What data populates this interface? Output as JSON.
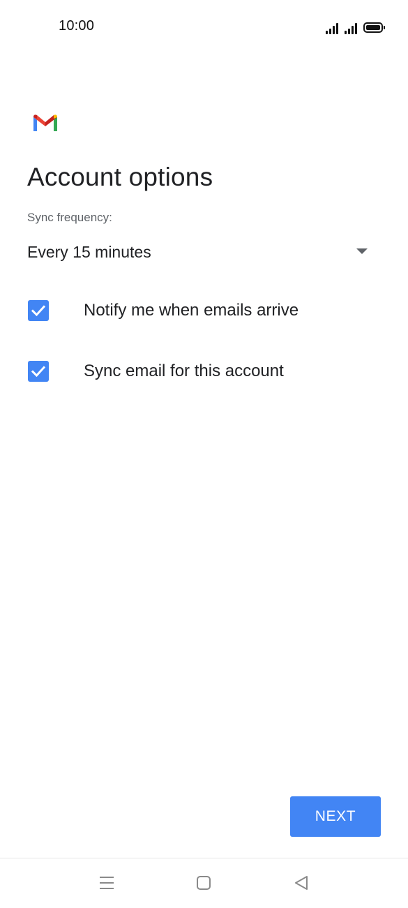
{
  "status_bar": {
    "time": "10:00",
    "icons": [
      "signal-icon",
      "signal-icon",
      "battery-icon"
    ]
  },
  "app": {
    "logo_icon": "gmail-logo-icon"
  },
  "page": {
    "title": "Account options",
    "sync_label": "Sync frequency:",
    "sync_value": "Every 15 minutes",
    "options": [
      {
        "label": "Notify me when emails arrive",
        "checked": true
      },
      {
        "label": "Sync email for this account",
        "checked": true
      }
    ],
    "next_label": "NEXT"
  },
  "nav_bar": {
    "icons": [
      "menu-icon",
      "home-icon",
      "back-icon"
    ]
  },
  "colors": {
    "accent": "#4285f4",
    "text_primary": "#202124",
    "text_secondary": "#5f6368"
  }
}
